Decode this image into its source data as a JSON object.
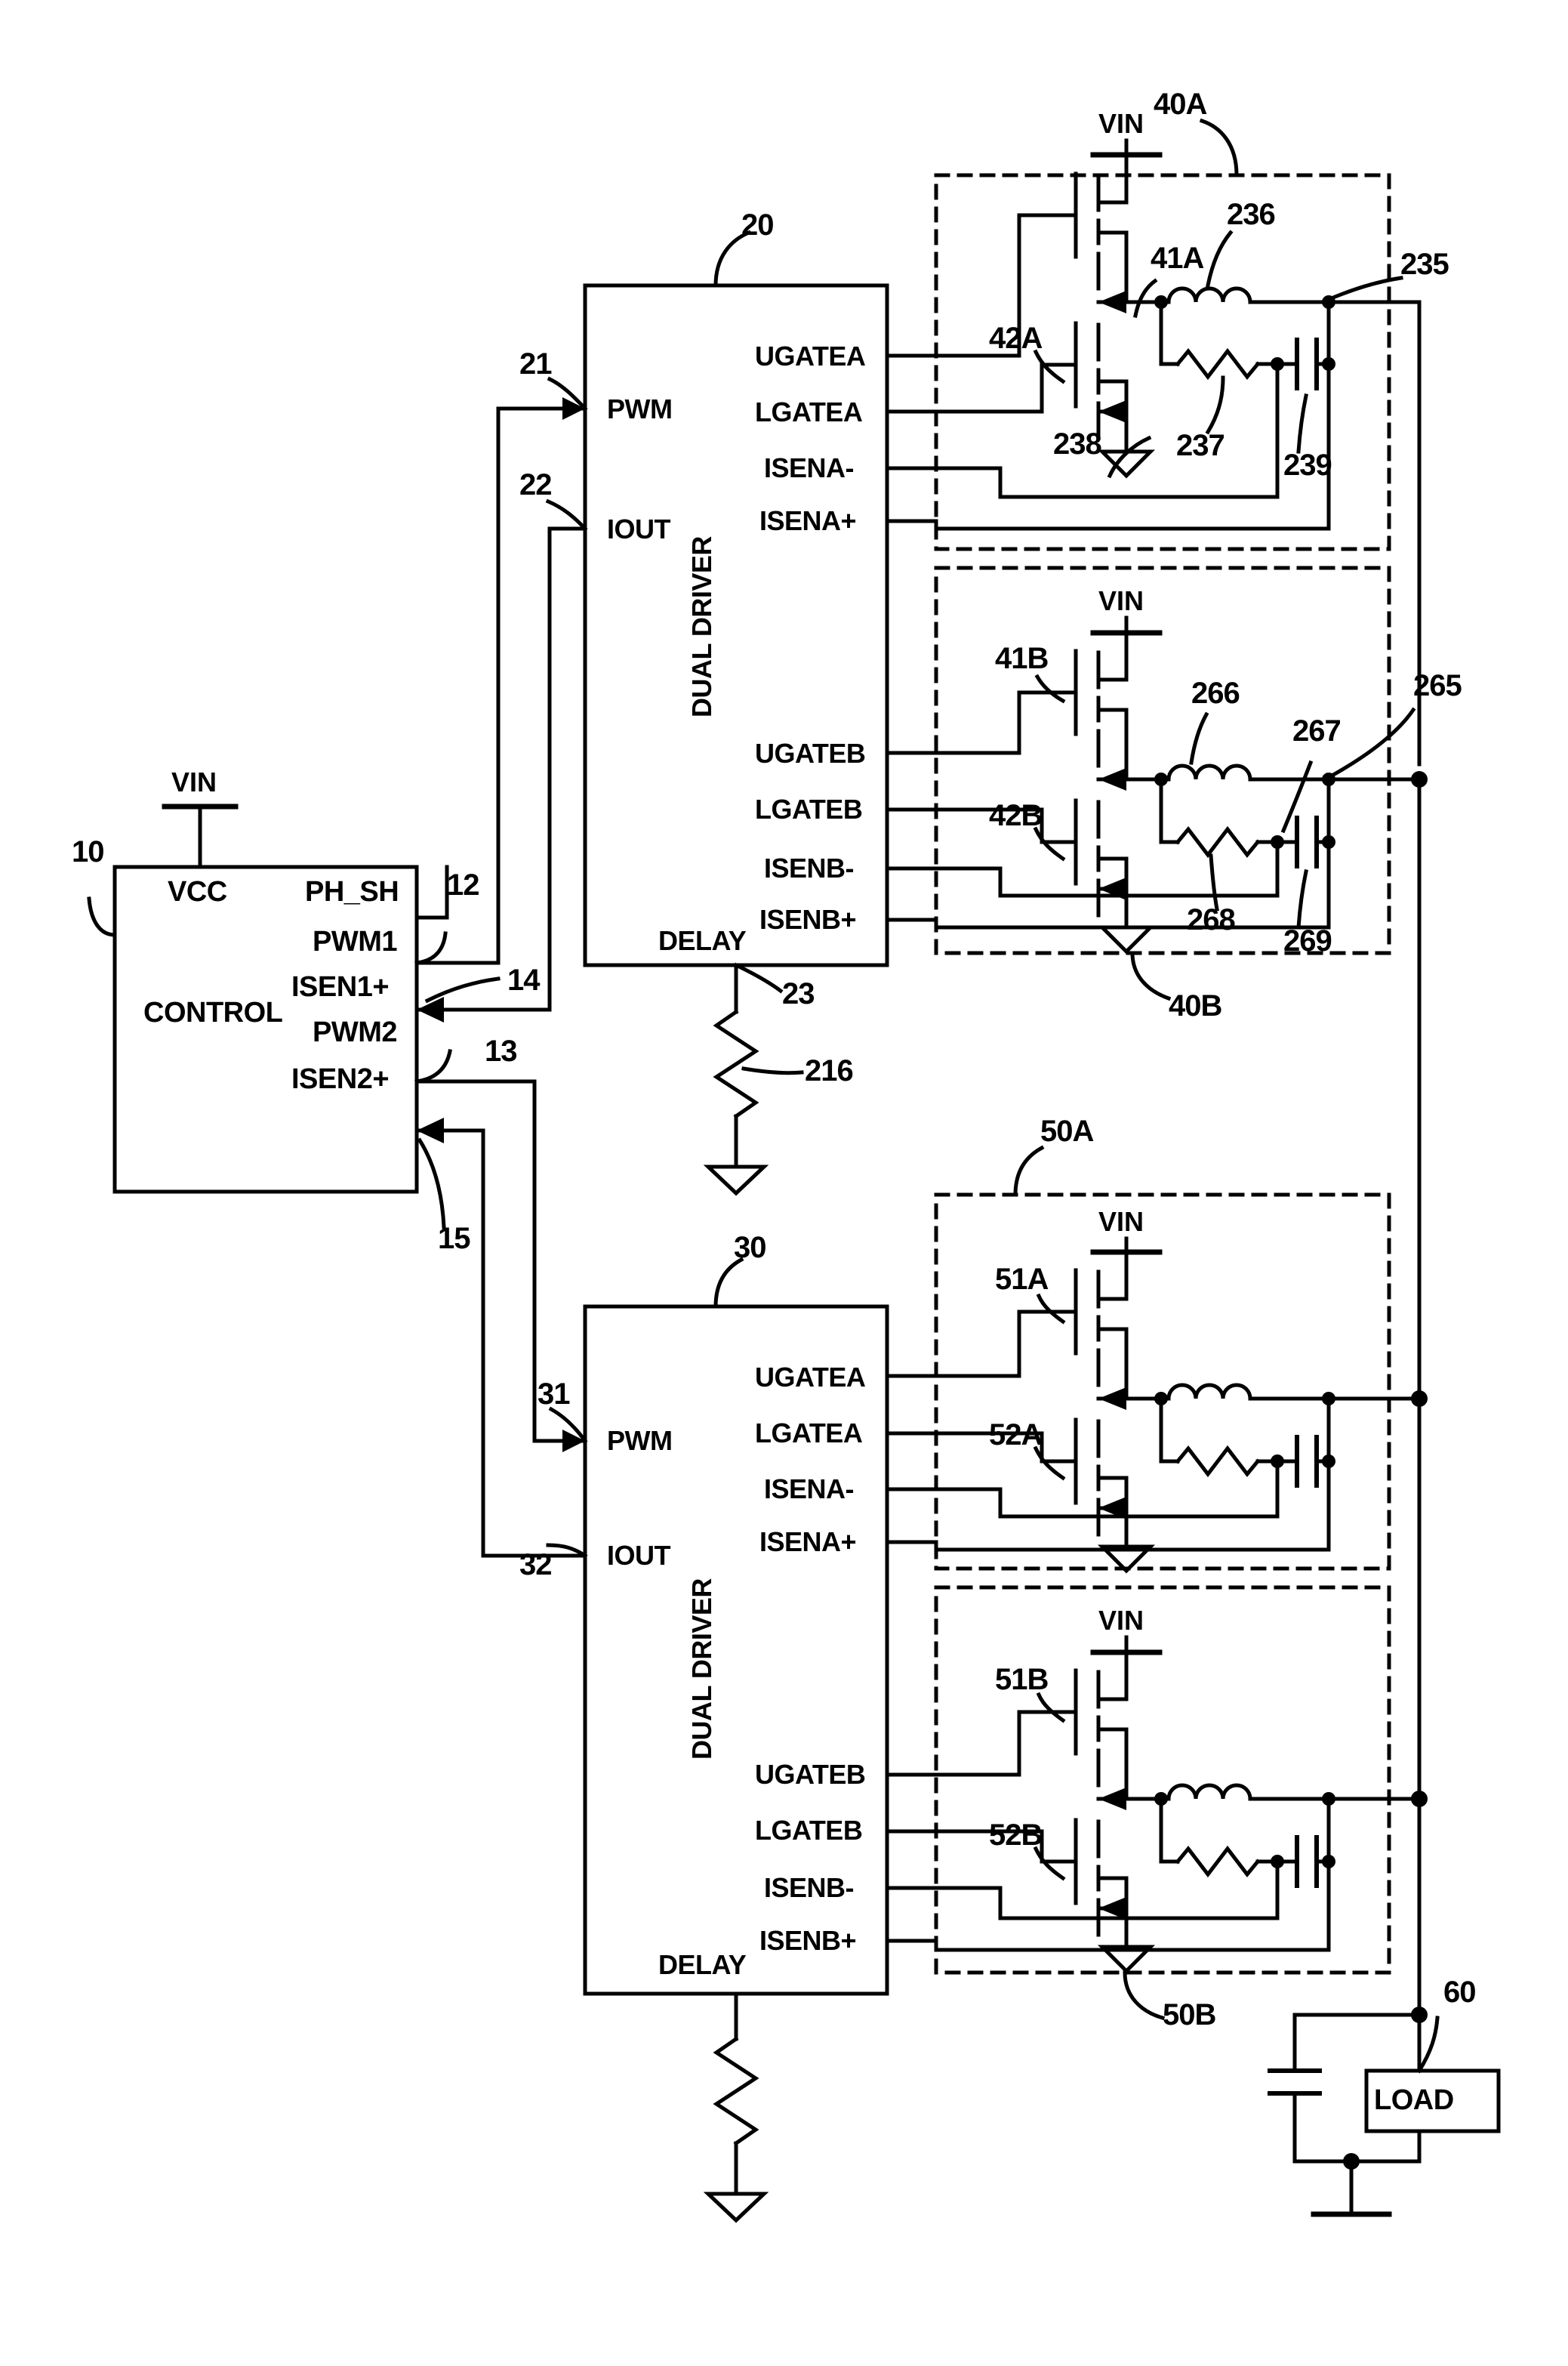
{
  "figure": {
    "type": "patent-circuit-schematic",
    "description": "Multiphase DC-DC converter with CONTROL IC driving two DUAL DRIVER ICs, each driving two power stages into a common LOAD"
  },
  "control_block": {
    "ref": "10",
    "title": "CONTROL",
    "supply_label": "VIN",
    "pins_left": [
      "VCC"
    ],
    "pins_right": [
      "PH_SH",
      "PWM1",
      "ISEN1+",
      "PWM2",
      "ISEN2+"
    ]
  },
  "driver_top": {
    "ref": "20",
    "title": "DUAL DRIVER",
    "pins_left": [
      "PWM",
      "IOUT",
      "DELAY"
    ],
    "pins_right": [
      "UGATEA",
      "LGATEA",
      "ISENA-",
      "ISENA+",
      "UGATEB",
      "LGATEB",
      "ISENB-",
      "ISENB+"
    ]
  },
  "driver_bottom": {
    "ref": "30",
    "title": "DUAL DRIVER",
    "pins_left": [
      "PWM",
      "IOUT",
      "DELAY"
    ],
    "pins_right": [
      "UGATEA",
      "LGATEA",
      "ISENA-",
      "ISENA+",
      "UGATEB",
      "LGATEB",
      "ISENB-",
      "ISENB+"
    ]
  },
  "nets": {
    "ph_sh_to_pwm": "12",
    "isen1_feedback": "14",
    "pwm2_out": "13",
    "isen2_feedback": "15",
    "pwm_in_top": "21",
    "iout_top": "22",
    "delay_top": "23",
    "pwm_in_bottom": "31",
    "iout_bottom": "32"
  },
  "power_stage_40a": {
    "ref": "40A",
    "supply_label": "VIN",
    "upper_fet": "41A",
    "lower_fet": "42A",
    "inductor": "236",
    "output_node": "235",
    "resistor": "237",
    "ground_symbol": "238",
    "capacitor": "239"
  },
  "power_stage_40b": {
    "ref": "40B",
    "supply_label": "VIN",
    "upper_fet": "41B",
    "lower_fet": "42B",
    "inductor": "266",
    "output_node": "265",
    "resistor": "267",
    "ground_symbol": "268",
    "capacitor": "269"
  },
  "power_stage_50a": {
    "ref": "50A",
    "supply_label": "VIN",
    "upper_fet": "51A",
    "lower_fet": "52A"
  },
  "power_stage_50b": {
    "ref": "50B",
    "supply_label": "VIN",
    "upper_fet": "51B",
    "lower_fet": "52B"
  },
  "delay_resistor_top": "216",
  "load": {
    "ref": "60",
    "label": "LOAD"
  }
}
